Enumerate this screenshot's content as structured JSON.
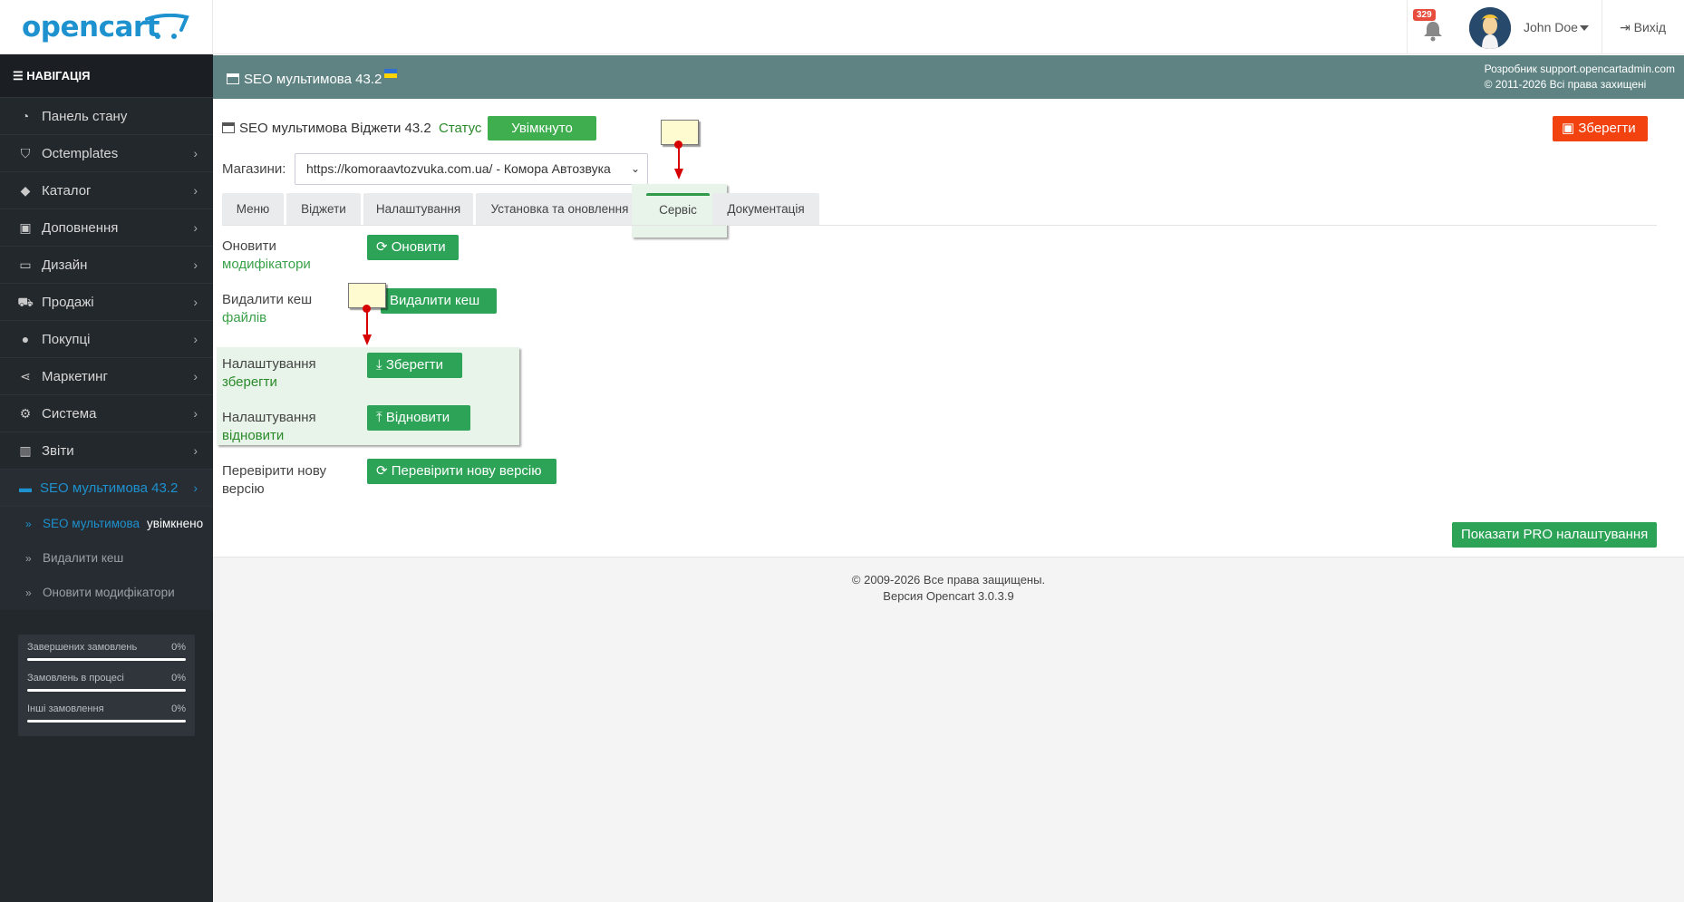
{
  "header": {
    "logo_text": "opencart",
    "notifications_count": "329",
    "user_name": "John Doe",
    "logout_label": "Вихід"
  },
  "sidebar": {
    "nav_title": "НАВІГАЦІЯ",
    "items": [
      {
        "label": "Панель стану",
        "icon": "dashboard-icon"
      },
      {
        "label": "Octemplates",
        "icon": "shield-icon"
      },
      {
        "label": "Каталог",
        "icon": "tags-icon"
      },
      {
        "label": "Доповнення",
        "icon": "puzzle-icon"
      },
      {
        "label": "Дизайн",
        "icon": "monitor-icon"
      },
      {
        "label": "Продажі",
        "icon": "cart-icon"
      },
      {
        "label": "Покупці",
        "icon": "user-icon"
      },
      {
        "label": "Маркетинг",
        "icon": "share-icon"
      },
      {
        "label": "Система",
        "icon": "gear-icon"
      },
      {
        "label": "Звіти",
        "icon": "bar-chart-icon"
      },
      {
        "label": "SEO мультимова 43.2",
        "icon": "window-icon"
      }
    ],
    "sub_items": [
      {
        "label": "SEO мультимова",
        "extra": "увімкнено"
      },
      {
        "label": "Видалити кеш",
        "extra": ""
      },
      {
        "label": "Оновити модифікатори",
        "extra": ""
      }
    ],
    "stats": [
      {
        "label": "Завершених замовлень",
        "value": "0%"
      },
      {
        "label": "Замовлень в процесі",
        "value": "0%"
      },
      {
        "label": "Інші замовлення",
        "value": "0%"
      }
    ]
  },
  "pagebar": {
    "title": "SEO мультимова 43.2",
    "developer": "Розробник support.opencartadmin.com",
    "copyright": "© 2011-2026 Всі права захищені"
  },
  "module": {
    "title": "SEO мультимова Віджети 43.2",
    "status_label": "Статус",
    "status_value": "Увімкнуто",
    "save_button": "Зберегти",
    "stores_label": "Магазини:",
    "store_selected": "https://komoraavtozvuka.com.ua/ - Комора Автозвука"
  },
  "tabs": [
    "Меню",
    "Віджети",
    "Налаштування",
    "Установка та оновлення",
    "Сервіс",
    "Документація"
  ],
  "service": {
    "rows": [
      {
        "label": "Оновити",
        "sub": "модифікатори",
        "button": "Оновити"
      },
      {
        "label": "Видалити кеш",
        "sub": "файлів",
        "button": "Видалити кеш"
      },
      {
        "label": "Налаштування",
        "sub": "зберегти",
        "button": "Зберегти"
      },
      {
        "label": "Налаштування",
        "sub": "відновити",
        "button": "Відновити"
      },
      {
        "label": "Перевірити нову",
        "sub": "версію",
        "button": "Перевірити нову версію"
      }
    ],
    "pro_button": "Показати PRO налаштування"
  },
  "footer": {
    "line1": "© 2009-2026 Все права защищены.",
    "line2": "Версия Opencart 3.0.3.9"
  },
  "colors": {
    "sidebar_bg": "#23282d",
    "accent_blue": "#1e91cf",
    "pagebar_bg": "#5f8383",
    "button_green": "#2ca356",
    "button_red": "#f2420f"
  }
}
